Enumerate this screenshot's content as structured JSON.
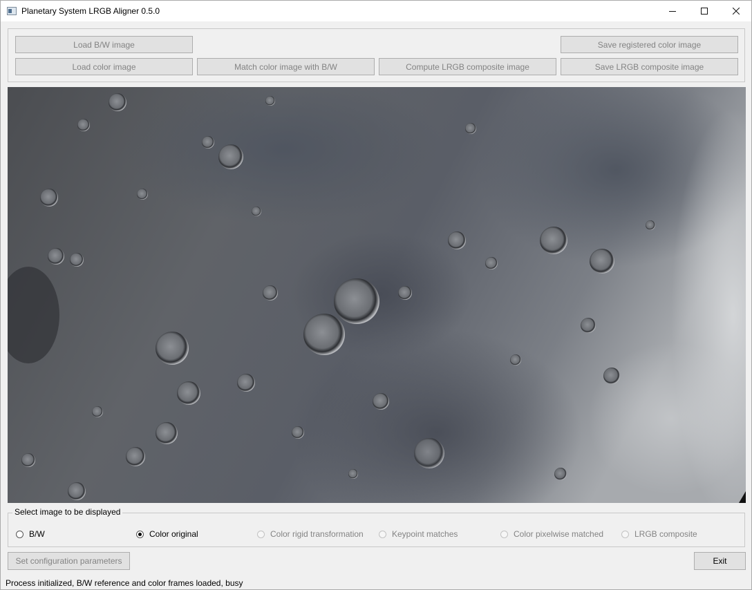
{
  "window": {
    "title": "Planetary System LRGB Aligner 0.5.0",
    "minimize_icon": "minimize-icon",
    "maximize_icon": "maximize-icon",
    "close_icon": "close-icon"
  },
  "toolbar": {
    "load_bw": "Load B/W image",
    "load_color": "Load color image",
    "match_color": "Match color image with B/W",
    "compute_lrgb": "Compute LRGB composite image",
    "save_registered": "Save registered color image",
    "save_lrgb": "Save LRGB composite image"
  },
  "viewer": {
    "content": "lunar surface image"
  },
  "display_group": {
    "title": "Select image to be displayed",
    "options": [
      {
        "label": "B/W",
        "checked": false,
        "enabled": true
      },
      {
        "label": "Color original",
        "checked": true,
        "enabled": true
      },
      {
        "label": "Color rigid transformation",
        "checked": false,
        "enabled": false
      },
      {
        "label": "Keypoint matches",
        "checked": false,
        "enabled": false
      },
      {
        "label": "Color pixelwise matched",
        "checked": false,
        "enabled": false
      },
      {
        "label": "LRGB composite",
        "checked": false,
        "enabled": false
      }
    ]
  },
  "bottom": {
    "config_button": "Set configuration parameters",
    "exit_button": "Exit"
  },
  "status": "Process initialized, B/W reference and color frames loaded, busy",
  "colors": {
    "window_bg": "#f0f0f0",
    "disabled_text": "#838383",
    "button_bg": "#e1e1e1"
  }
}
